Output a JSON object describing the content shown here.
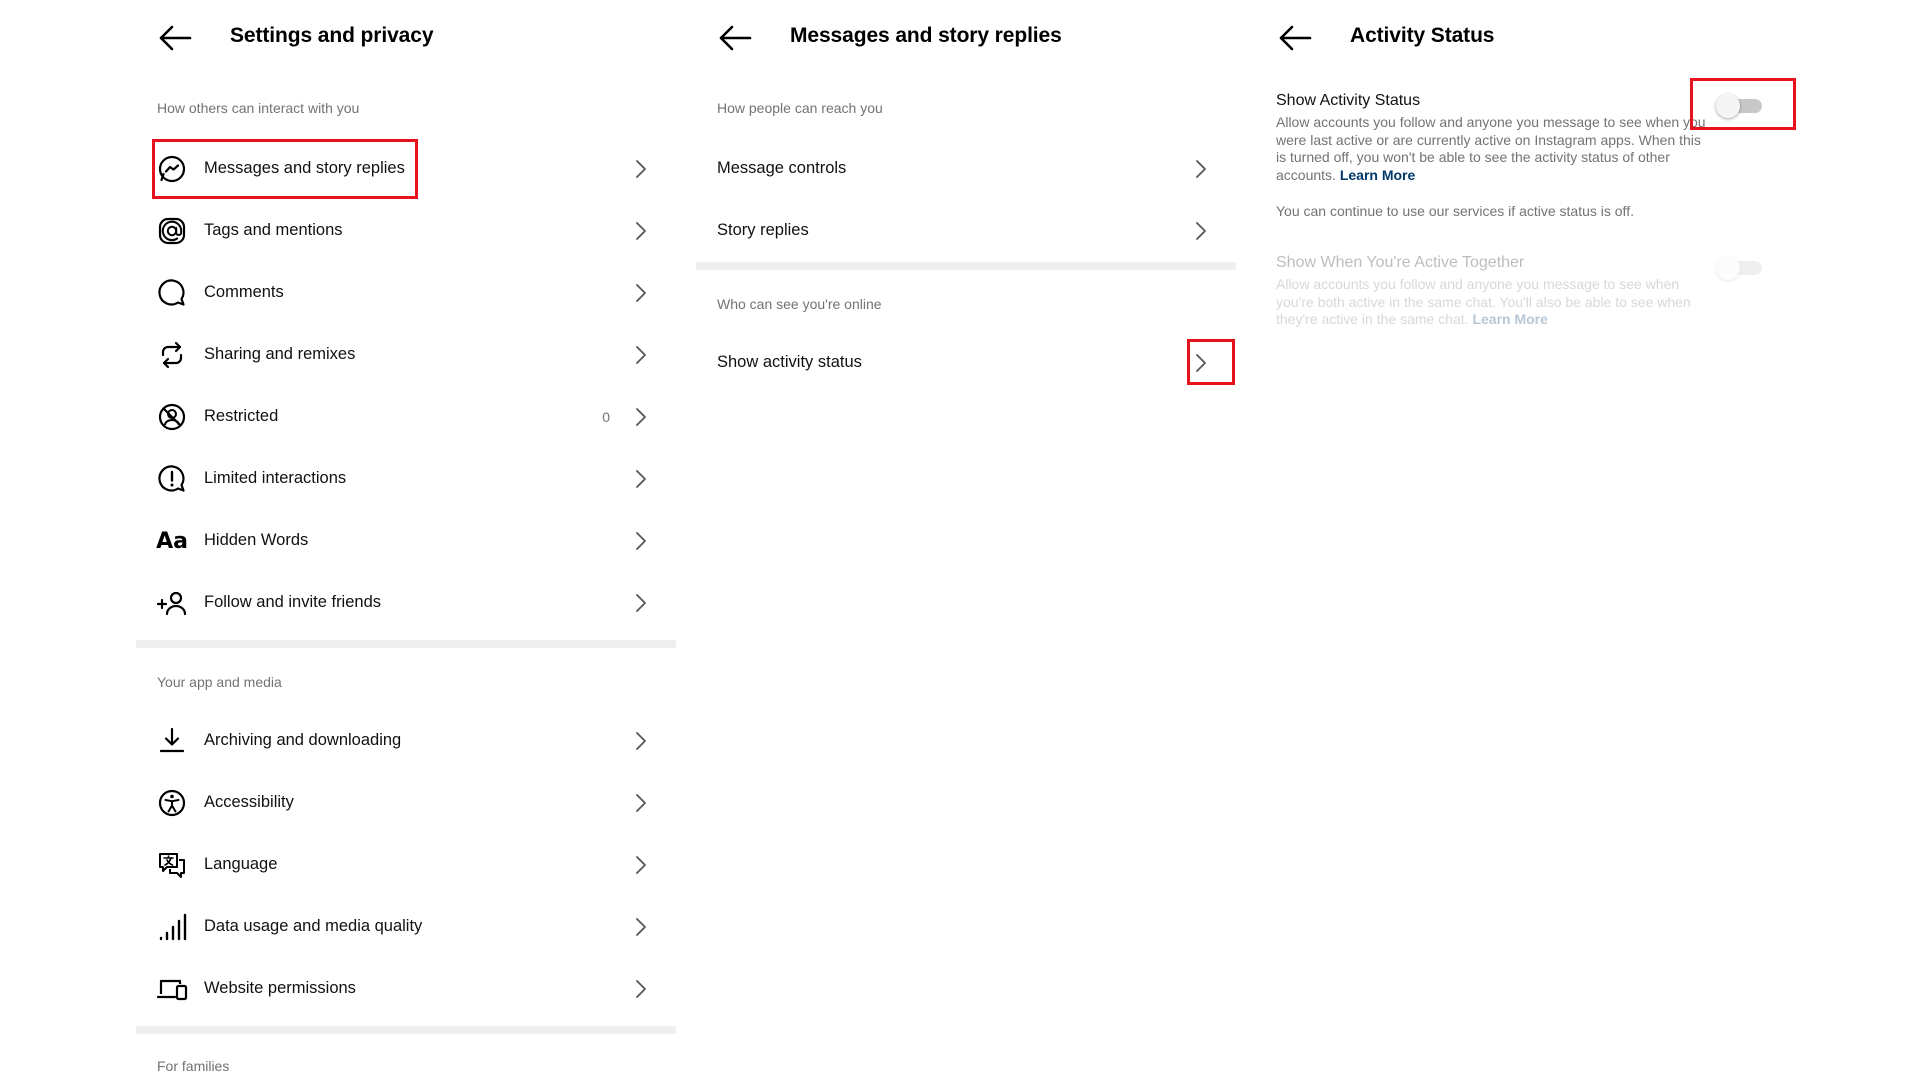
{
  "panel1": {
    "title": "Settings and privacy",
    "section_interact": "How others can interact with you",
    "items_interact": [
      {
        "label": "Messages and story replies",
        "icon": "messenger-icon"
      },
      {
        "label": "Tags and mentions",
        "icon": "at-sign-icon"
      },
      {
        "label": "Comments",
        "icon": "comment-icon"
      },
      {
        "label": "Sharing and remixes",
        "icon": "remix-icon"
      },
      {
        "label": "Restricted",
        "icon": "restricted-icon",
        "count": "0"
      },
      {
        "label": "Limited interactions",
        "icon": "limited-interactions-icon"
      },
      {
        "label": "Hidden Words",
        "icon": "hidden-words-icon",
        "glyph": "Aa"
      },
      {
        "label": "Follow and invite friends",
        "icon": "add-person-icon"
      }
    ],
    "section_app": "Your app and media",
    "items_app": [
      {
        "label": "Archiving and downloading",
        "icon": "download-icon"
      },
      {
        "label": "Accessibility",
        "icon": "accessibility-icon"
      },
      {
        "label": "Language",
        "icon": "language-icon"
      },
      {
        "label": "Data usage and media quality",
        "icon": "signal-bars-icon"
      },
      {
        "label": "Website permissions",
        "icon": "devices-icon"
      }
    ],
    "section_families": "For families"
  },
  "panel2": {
    "title": "Messages and story replies",
    "section_reach": "How people can reach you",
    "items_reach": [
      {
        "label": "Message controls"
      },
      {
        "label": "Story replies"
      }
    ],
    "section_online": "Who can see you're online",
    "items_online": [
      {
        "label": "Show activity status"
      }
    ]
  },
  "panel3": {
    "title": "Activity Status",
    "show_status": {
      "title": "Show Activity Status",
      "desc": "Allow accounts you follow and anyone you message to see when you were last active or are currently active on Instagram apps. When this is turned off, you won't be able to see the activity status of other accounts.",
      "link": "Learn More",
      "enabled": false
    },
    "note": "You can continue to use our services if active status is off.",
    "active_together": {
      "title": "Show When You're Active Together",
      "desc": "Allow accounts you follow and anyone you message to see when you're both active in the same chat. You'll also be able to see when they're active in the same chat.",
      "link": "Learn More",
      "enabled": false,
      "disabled": true
    }
  },
  "colors": {
    "highlight": "#e8121f",
    "secondary_text": "#737373",
    "link": "#00376b",
    "divider": "#efefef"
  }
}
